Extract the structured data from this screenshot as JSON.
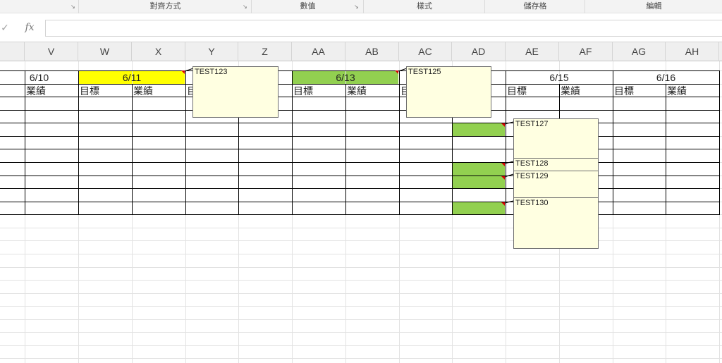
{
  "ribbon": {
    "groups": [
      {
        "label": "對齊方式"
      },
      {
        "label": "數值"
      },
      {
        "label": "樣式"
      },
      {
        "label": "儲存格"
      },
      {
        "label": "編輯"
      }
    ],
    "launcher_glyph": "↘"
  },
  "formula_bar": {
    "enter_glyph": "✓",
    "fx_label": "fx",
    "value": ""
  },
  "columns": [
    "V",
    "W",
    "X",
    "Y",
    "Z",
    "AA",
    "AB",
    "AC",
    "AD",
    "AE",
    "AF",
    "AG",
    "AH"
  ],
  "dates": [
    "6/10",
    "6/11",
    "6/13",
    "6/15",
    "6/16"
  ],
  "labels": {
    "target": "目標",
    "performance": "業績"
  },
  "comments": [
    "TEST123",
    "TEST125",
    "TEST127",
    "TEST128",
    "TEST129",
    "TEST130"
  ],
  "colors": {
    "yellow_fill": "#ffff00",
    "green_fill": "#92d050",
    "comment_bg": "#ffffe1",
    "comment_indicator": "#d40000"
  }
}
